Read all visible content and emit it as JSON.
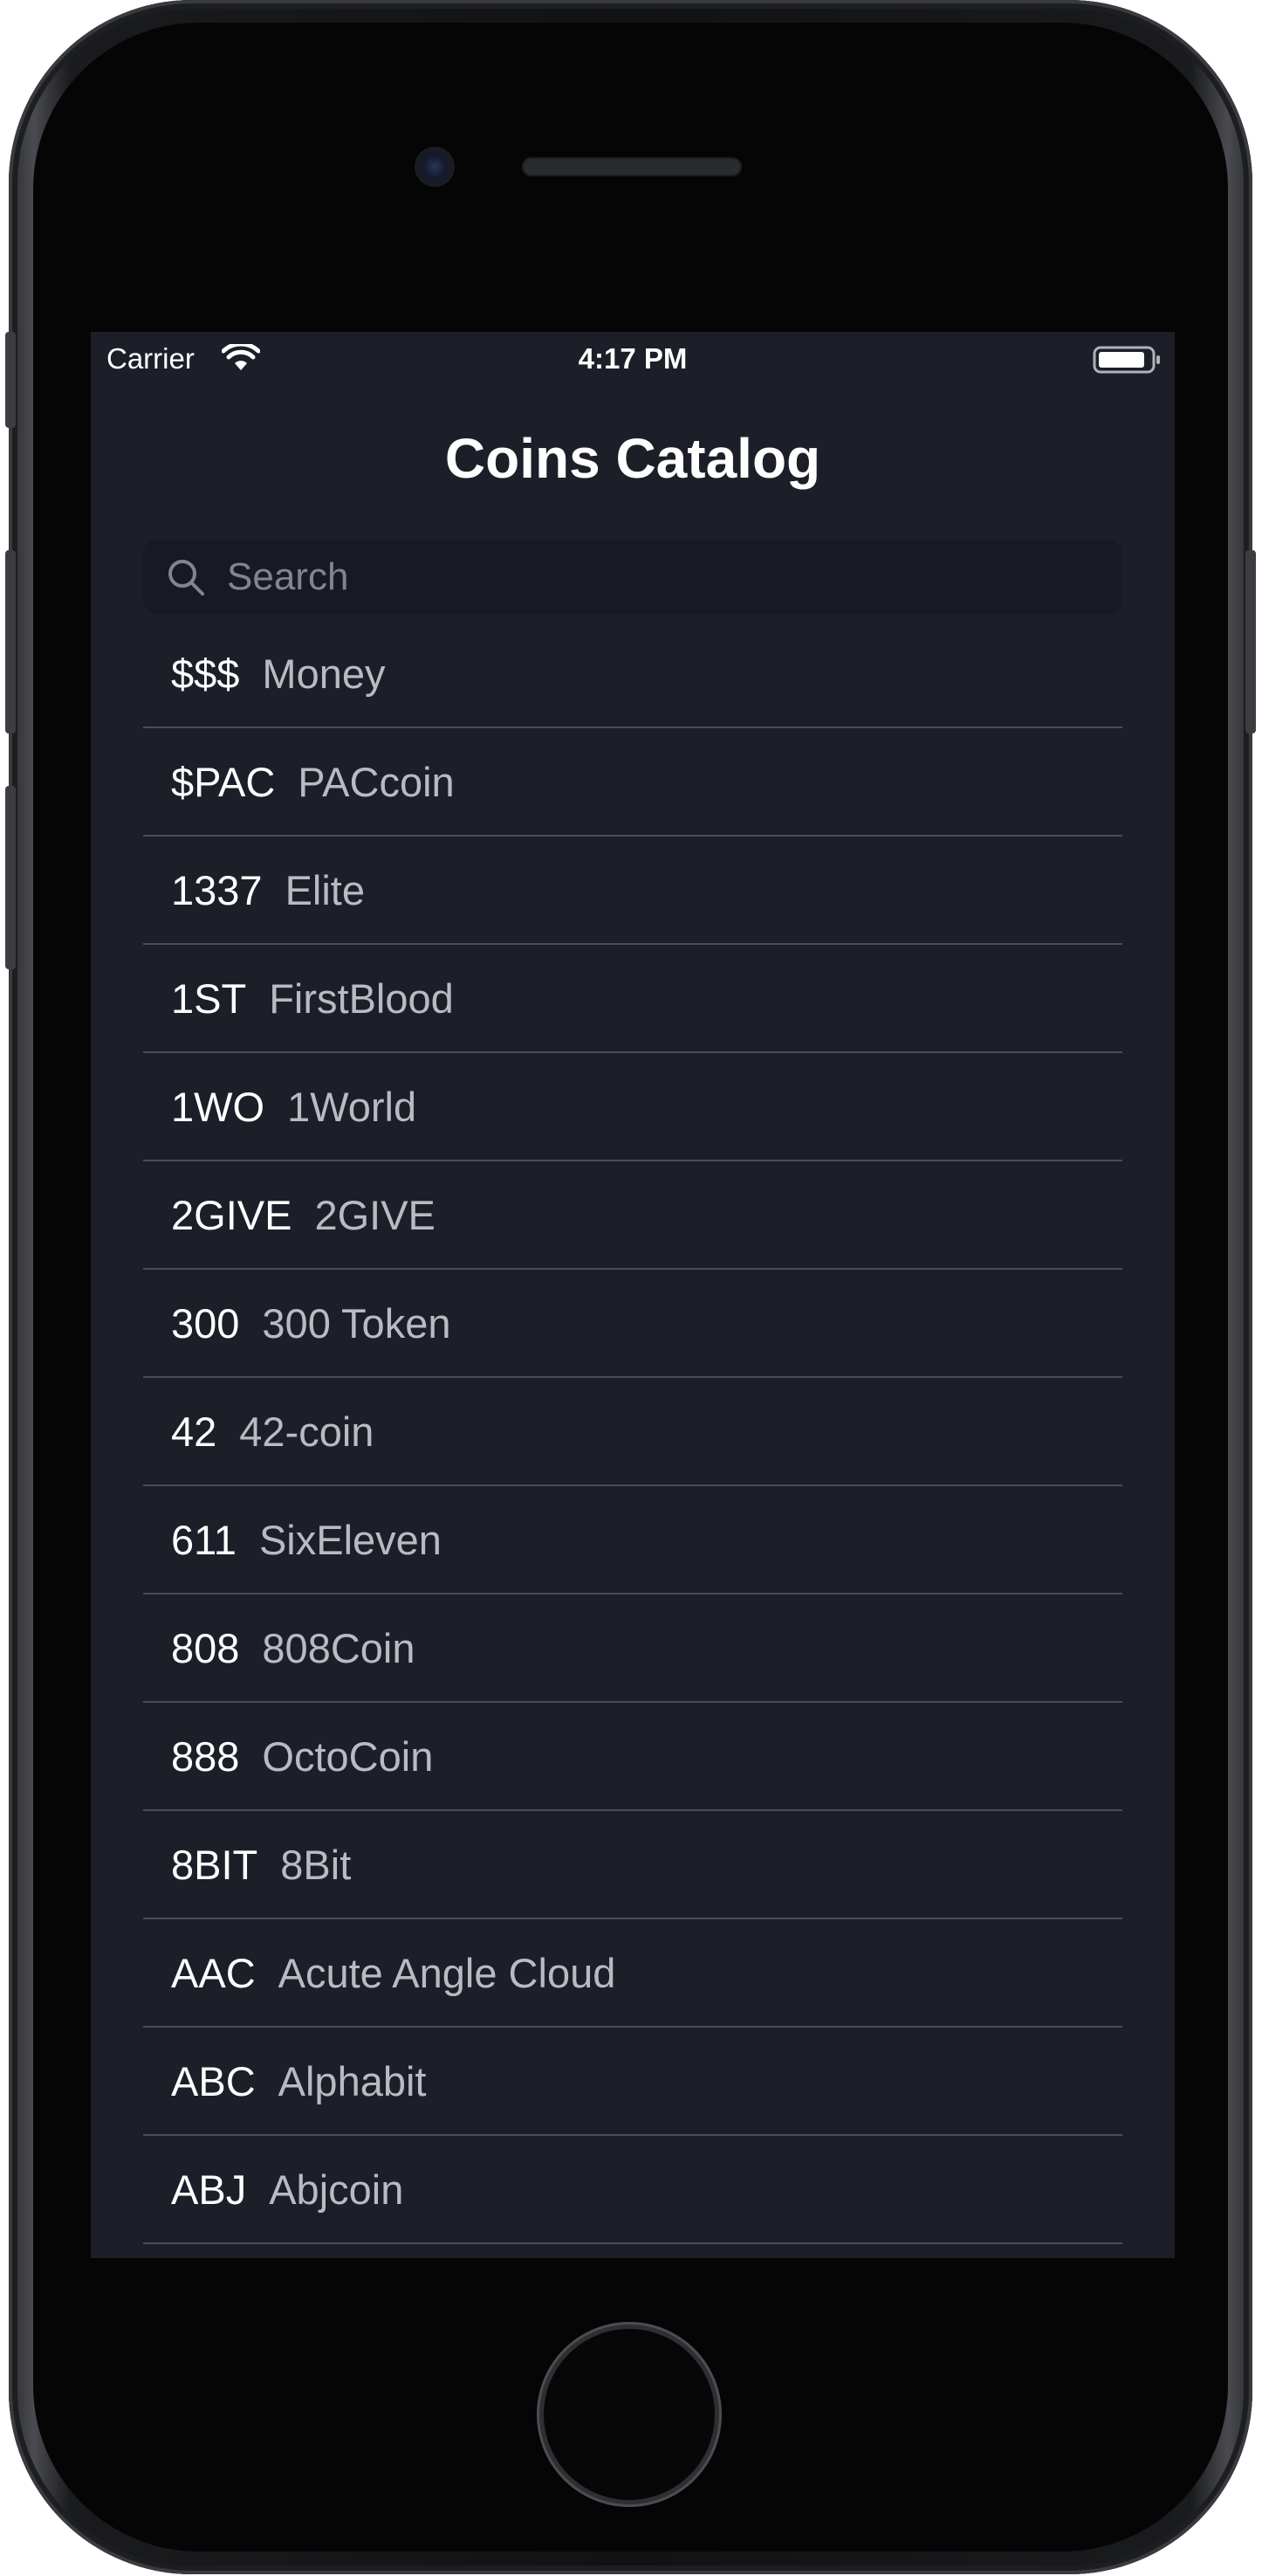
{
  "status_bar": {
    "carrier": "Carrier",
    "time": "4:17 PM",
    "wifi_icon": "wifi-icon",
    "battery_icon": "battery-icon"
  },
  "navigation": {
    "title": "Coins Catalog"
  },
  "search": {
    "placeholder": "Search",
    "value": "",
    "icon": "search-icon"
  },
  "coins": [
    {
      "symbol": "$$$",
      "name": "Money"
    },
    {
      "symbol": "$PAC",
      "name": "PACcoin"
    },
    {
      "symbol": "1337",
      "name": "Elite"
    },
    {
      "symbol": "1ST",
      "name": "FirstBlood"
    },
    {
      "symbol": "1WO",
      "name": "1World"
    },
    {
      "symbol": "2GIVE",
      "name": "2GIVE"
    },
    {
      "symbol": "300",
      "name": "300 Token"
    },
    {
      "symbol": "42",
      "name": "42-coin"
    },
    {
      "symbol": "611",
      "name": "SixEleven"
    },
    {
      "symbol": "808",
      "name": "808Coin"
    },
    {
      "symbol": "888",
      "name": "OctoCoin"
    },
    {
      "symbol": "8BIT",
      "name": "8Bit"
    },
    {
      "symbol": "AAC",
      "name": "Acute Angle Cloud"
    },
    {
      "symbol": "ABC",
      "name": "Alphabit"
    },
    {
      "symbol": "ABJ",
      "name": "Abjcoin"
    }
  ],
  "colors": {
    "background": "#1c1f28",
    "search_field": "#171a22",
    "separator": "#4a4d56",
    "symbol_text": "#ffffff",
    "name_text": "#b8bbc2"
  }
}
